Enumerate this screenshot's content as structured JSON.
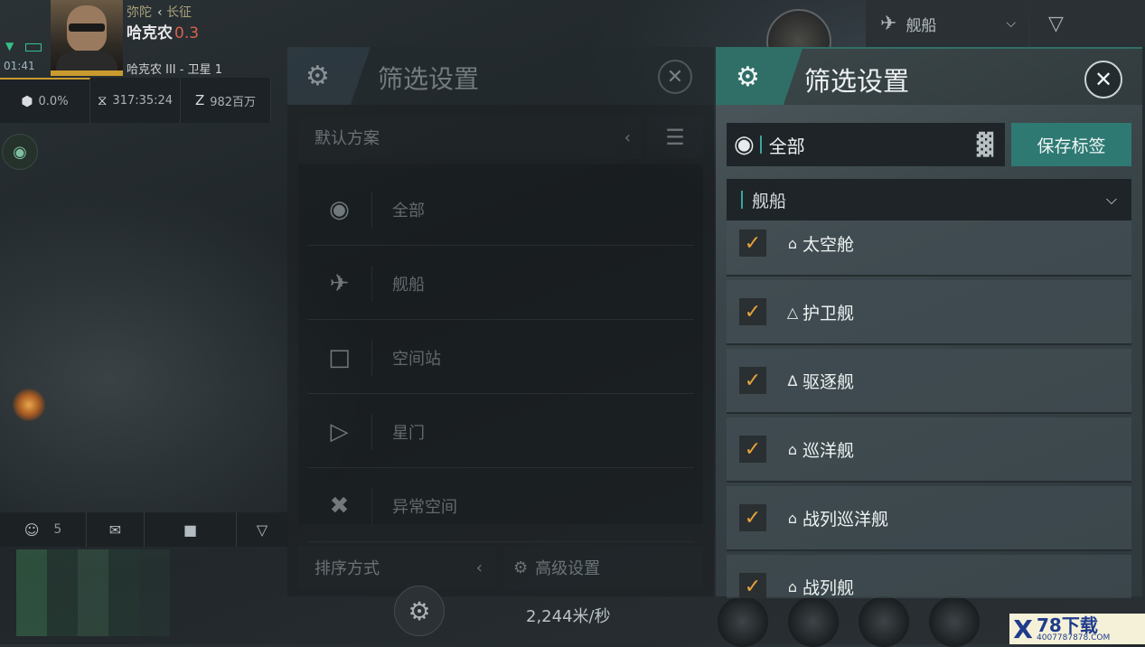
{
  "hud": {
    "time": "01:41",
    "region": "弥陀",
    "constellation": "长征",
    "system": "哈克农",
    "security": "0.3",
    "planet": "哈克农 III - 卫星 1",
    "stats": [
      "0.0%",
      "317:35:24",
      "982百万"
    ]
  },
  "chat": {
    "member_count": "5"
  },
  "toolbar": {
    "filter_label": "舰船"
  },
  "dim_panel": {
    "title": "筛选设置",
    "preset": "默认方案",
    "items": [
      {
        "icon": "eye-icon",
        "label": "全部"
      },
      {
        "icon": "ship-icon",
        "label": "舰船"
      },
      {
        "icon": "square-icon",
        "label": "空间站"
      },
      {
        "icon": "stargate-icon",
        "label": "星门"
      },
      {
        "icon": "anomaly-icon",
        "label": "异常空间"
      }
    ],
    "sort_label": "排序方式",
    "advanced_label": "高级设置"
  },
  "speed": "2,244米/秒",
  "panel": {
    "title": "筛选设置",
    "preset_label": "全部",
    "save_label": "保存标签",
    "category": "舰船",
    "ship_classes": [
      {
        "label": "太空舱",
        "checked": true
      },
      {
        "label": "护卫舰",
        "checked": true
      },
      {
        "label": "驱逐舰",
        "checked": true
      },
      {
        "label": "巡洋舰",
        "checked": true
      },
      {
        "label": "战列巡洋舰",
        "checked": true
      },
      {
        "label": "战列舰",
        "checked": true
      }
    ]
  },
  "colors": {
    "accent": "#2e7a73",
    "check": "#e8a33c",
    "security": "#d6634e"
  },
  "watermark": {
    "brand": "78下载",
    "url": "4007787878.COM"
  }
}
